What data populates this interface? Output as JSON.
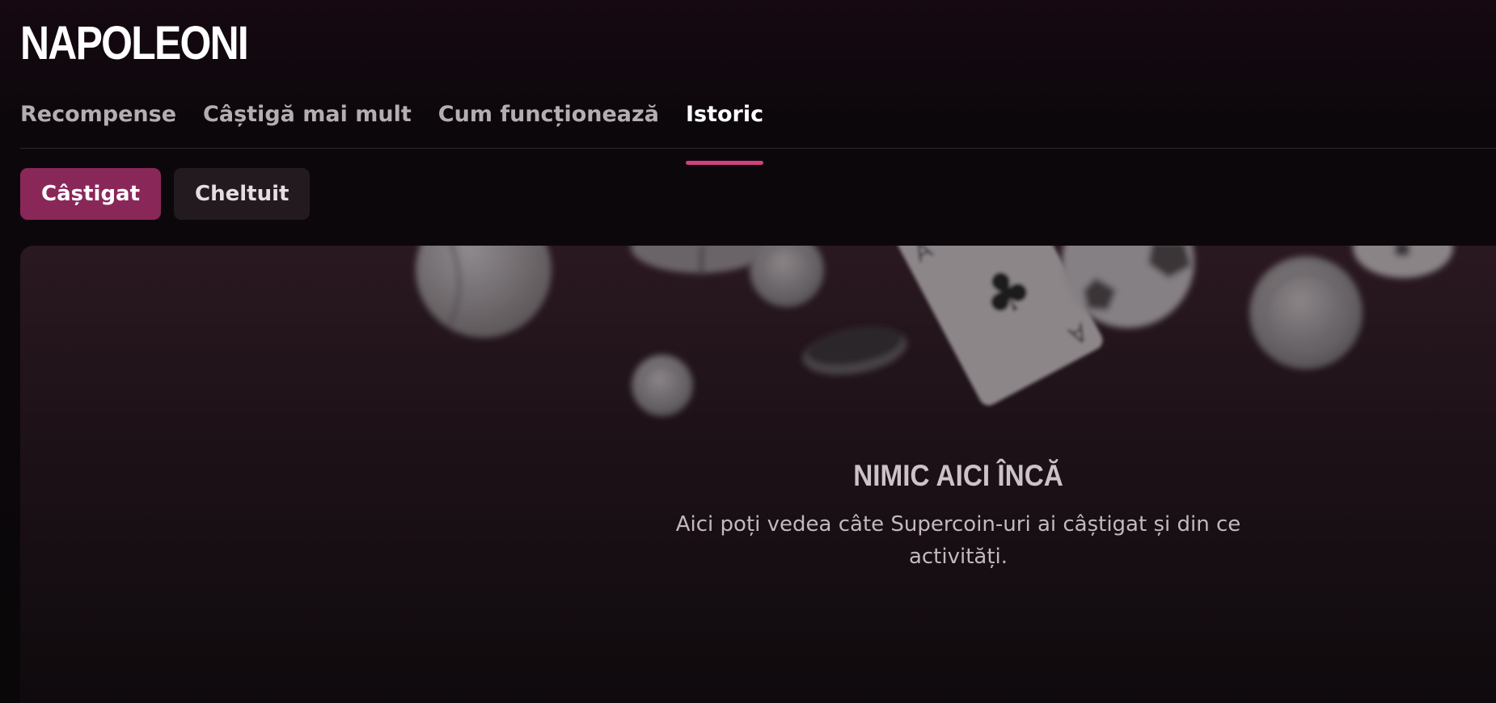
{
  "app": {
    "title": "NAPOLEONI"
  },
  "nav": {
    "tabs": [
      {
        "label": "Recompense"
      },
      {
        "label": "Câștigă mai mult"
      },
      {
        "label": "Cum funcționează"
      },
      {
        "label": "Istoric"
      }
    ],
    "active_tab": "Istoric"
  },
  "filters": {
    "earned_label": "Câștigat",
    "spent_label": "Cheltuit",
    "active": "Câștigat"
  },
  "empty_state": {
    "title": "NIMIC AICI ÎNCĂ",
    "description": "Aici poți vedea câte Supercoin-uri ai câștigat și din ce activități."
  },
  "colors": {
    "accent": "#d2407f",
    "active_pill": "#8a2759",
    "background": "#0b0709"
  },
  "icons": [
    "tennis-ball-icon",
    "coin-icon",
    "playing-card-icon",
    "poker-chip-icon",
    "football-icon"
  ]
}
